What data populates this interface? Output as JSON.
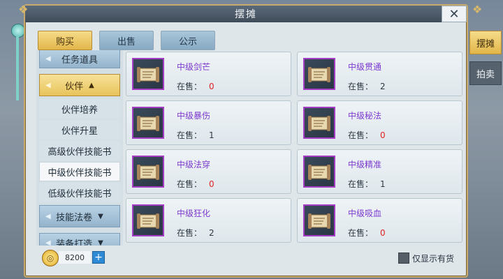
{
  "window": {
    "title": "摆摊"
  },
  "top_tabs": [
    {
      "label": "购买",
      "active": true
    },
    {
      "label": "出售",
      "active": false
    },
    {
      "label": "公示",
      "active": false
    }
  ],
  "right_tabs": [
    {
      "label": "摆摊",
      "active": true
    },
    {
      "label": "拍卖",
      "active": false
    }
  ],
  "sidebar": {
    "items": [
      {
        "label": "任务道具",
        "type": "category"
      },
      {
        "label": "伙伴",
        "type": "category-open"
      },
      {
        "label": "伙伴培养",
        "type": "sub"
      },
      {
        "label": "伙伴升星",
        "type": "sub"
      },
      {
        "label": "高级伙伴技能书",
        "type": "sub"
      },
      {
        "label": "中级伙伴技能书",
        "type": "sub-selected"
      },
      {
        "label": "低级伙伴技能书",
        "type": "sub"
      },
      {
        "label": "技能法卷",
        "type": "category"
      },
      {
        "label": "装备打造",
        "type": "category"
      }
    ]
  },
  "on_sale_label": "在售：",
  "items": [
    {
      "name": "中级剑芒",
      "stock": "0"
    },
    {
      "name": "中级贯通",
      "stock": "2"
    },
    {
      "name": "中级暴伤",
      "stock": "1"
    },
    {
      "name": "中级秘法",
      "stock": "0"
    },
    {
      "name": "中级法穿",
      "stock": "0"
    },
    {
      "name": "中级精准",
      "stock": "1"
    },
    {
      "name": "中级狂化",
      "stock": "2"
    },
    {
      "name": "中级吸血",
      "stock": "0"
    }
  ],
  "footer": {
    "currency_amount": "8200",
    "plus_label": "+",
    "only_in_stock_label": "仅显示有货"
  },
  "colors": {
    "active_tab": "#e2b64a",
    "inactive_tab": "#87a9c2",
    "item_name": "#7c3bd0",
    "zero_stock": "#e02424",
    "icon_border": "#a43dc4"
  },
  "icons": {
    "close": "close-icon",
    "coin": "gold-coin-icon",
    "item": "scroll-icon",
    "collapse": "triangle-up-icon",
    "expand": "triangle-down-icon"
  }
}
